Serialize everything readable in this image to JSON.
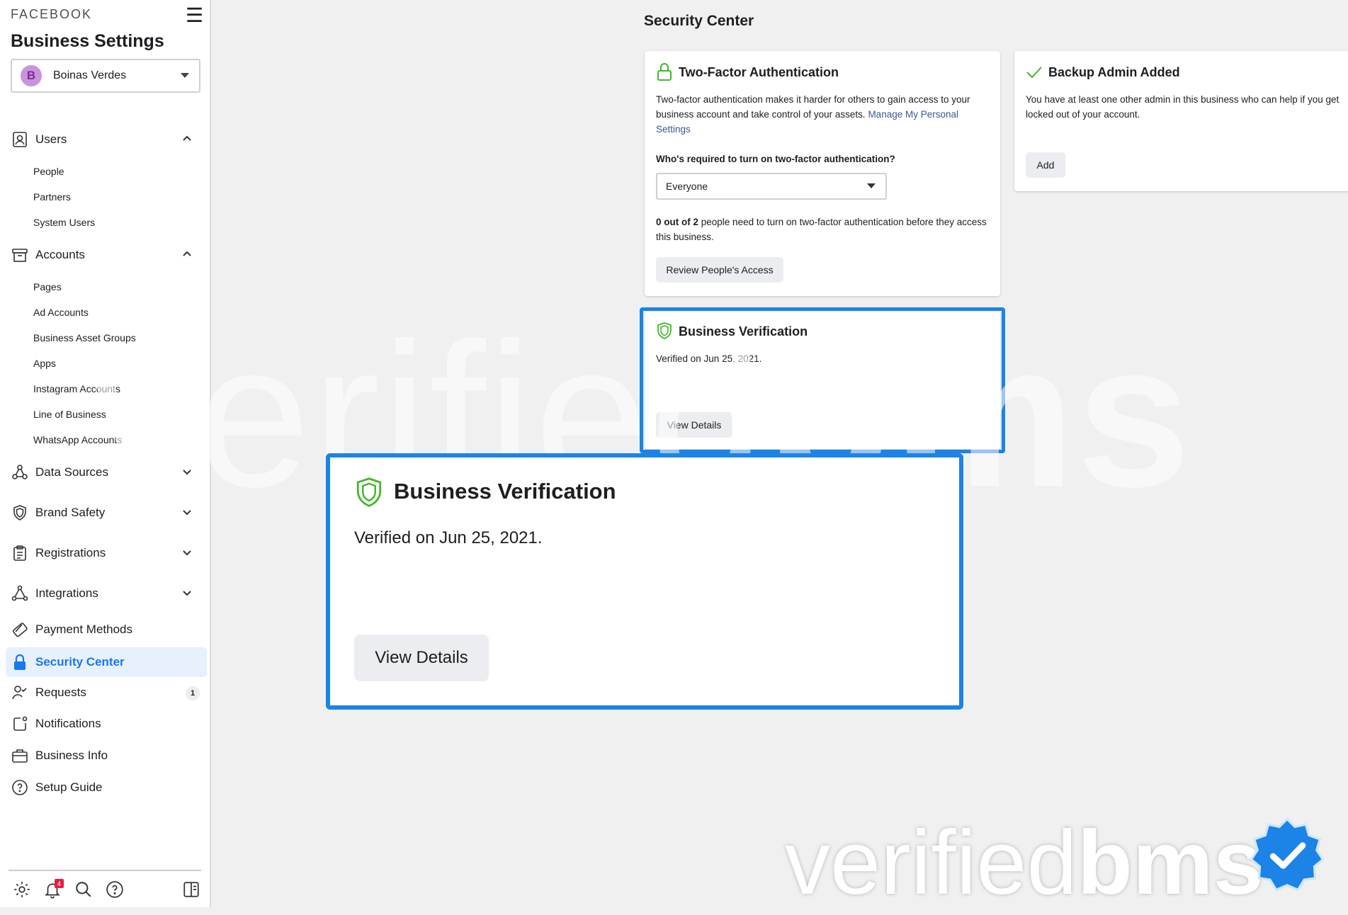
{
  "sidebar": {
    "brand": "FACEBOOK",
    "title": "Business Settings",
    "business": {
      "initial": "B",
      "name": "Boinas Verdes"
    },
    "groups": {
      "users": {
        "label": "Users",
        "children": [
          "People",
          "Partners",
          "System Users"
        ]
      },
      "accounts": {
        "label": "Accounts",
        "children": [
          "Pages",
          "Ad Accounts",
          "Business Asset Groups",
          "Apps",
          "Instagram Accounts",
          "Line of Business",
          "WhatsApp Accounts"
        ]
      }
    },
    "items": {
      "data_sources": "Data Sources",
      "brand_safety": "Brand Safety",
      "registrations": "Registrations",
      "integrations": "Integrations",
      "payment_methods": "Payment Methods",
      "security_center": "Security Center",
      "requests": "Requests",
      "requests_count": "1",
      "notifications": "Notifications",
      "business_info": "Business Info",
      "setup_guide": "Setup Guide"
    },
    "footer": {
      "notifications_count": "4"
    }
  },
  "main": {
    "heading": "Security Center",
    "two_factor": {
      "title": "Two-Factor Authentication",
      "description": "Two-factor authentication makes it harder for others to gain access to your business account and take control of your assets.",
      "link": "Manage My Personal Settings",
      "question": "Who's required to turn on two-factor authentication?",
      "selected": "Everyone",
      "status_bold": "0 out of 2",
      "status_rest": "people need to turn on two-factor authentication before they access this business.",
      "button": "Review People's Access"
    },
    "backup_admin": {
      "title": "Backup Admin Added",
      "description": "You have at least one other admin in this business who can help if you get locked out of your account.",
      "button": "Add"
    },
    "verification": {
      "title": "Business Verification",
      "status": "Verified on Jun 25, 2021.",
      "button": "View Details"
    }
  },
  "watermark": {
    "light": "verified",
    "bold": "bms"
  },
  "colors": {
    "accent": "#1877f2",
    "highlight": "#1b84e6",
    "shield": "#42b72a"
  }
}
